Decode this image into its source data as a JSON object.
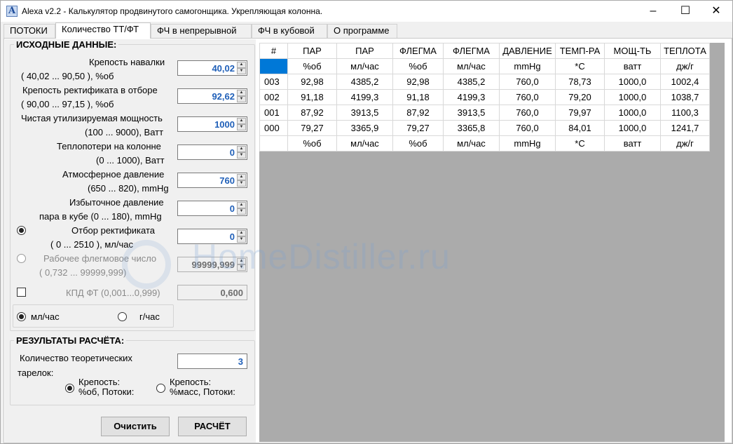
{
  "window": {
    "title": "Alexa  v2.2 - Калькулятор продвинутого самогонщика. Укрепляющая колонна.",
    "app_icon_letter": "A",
    "controls": {
      "minimize": "–",
      "maximize": "☐",
      "close": "✕"
    }
  },
  "tabs": [
    {
      "label": "ПОТОКИ",
      "active": false
    },
    {
      "label": "Количество ТТ/ФТ",
      "active": true
    },
    {
      "label": "ФЧ в непрерывной",
      "active": false
    },
    {
      "label": "ФЧ в кубовой",
      "active": false
    },
    {
      "label": "О программе",
      "active": false
    }
  ],
  "inputs": {
    "title": "ИСХОДНЫЕ ДАННЫЕ:",
    "fields": [
      {
        "label1": "Крепость навалки",
        "label2": "(       40,02     ...      90,50     ), %об",
        "value": "40,02"
      },
      {
        "label1": "Крепость ректификата в отборе",
        "label2": "(       90,00       ...      97,15 ), %об",
        "value": "92,62"
      },
      {
        "label1": "Чистая утилизируемая мощность",
        "label2": "(100 ... 9000), Ватт",
        "value": "1000"
      },
      {
        "label1": "Теплопотери на колонне",
        "label2": "(0 ... 1000), Ватт",
        "value": "0"
      },
      {
        "label1": "Атмосферное давление",
        "label2": "(650 ... 820), mmHg",
        "value": "760"
      },
      {
        "label1": "Избыточное давление",
        "label2": "пара в кубе (0 ... 180), mmHg",
        "value": "0"
      },
      {
        "label1": "Отбор ректификата",
        "label2": "(  0       ...       2510    ), мл/час",
        "value": "0"
      },
      {
        "label1": "Рабочее флегмовое число",
        "label2": "(       0,732      ... 99999,999)",
        "value": "99999,999"
      },
      {
        "label1": "КПД ФТ (0,001...0,999)",
        "value": "0,600"
      }
    ],
    "unit_options": {
      "ml": "мл/час",
      "g": "г/час"
    }
  },
  "results": {
    "title": "РЕЗУЛЬТАТЫ РАСЧЁТА:",
    "plates_label1": "Количество      теоретических",
    "plates_label2": "тарелок:",
    "plates_value": "3",
    "opt1_line1": "Крепость:",
    "opt1_line2": "%об, Потоки:",
    "opt2_line1": "Крепость:",
    "opt2_line2": "%масс, Потоки:"
  },
  "buttons": {
    "clear": "Очистить",
    "calc": "РАСЧЁТ"
  },
  "table": {
    "headers": [
      "#",
      "ПАР",
      "ПАР",
      "ФЛЕГМА",
      "ФЛЕГМА",
      "ДАВЛЕНИЕ",
      "ТЕМП-РА",
      "МОЩ-ТЬ",
      "ТЕПЛОТА"
    ],
    "units": [
      "",
      "%об",
      "мл/час",
      "%об",
      "мл/час",
      "mmHg",
      "*С",
      "ватт",
      "дж/г"
    ],
    "rows": [
      [
        "003",
        "92,98",
        "4385,2",
        "92,98",
        "4385,2",
        "760,0",
        "78,73",
        "1000,0",
        "1002,4"
      ],
      [
        "002",
        "91,18",
        "4199,3",
        "91,18",
        "4199,3",
        "760,0",
        "79,20",
        "1000,0",
        "1038,7"
      ],
      [
        "001",
        "87,92",
        "3913,5",
        "87,92",
        "3913,5",
        "760,0",
        "79,97",
        "1000,0",
        "1100,3"
      ],
      [
        "000",
        "79,27",
        "3365,9",
        "79,27",
        "3365,8",
        "760,0",
        "84,01",
        "1000,0",
        "1241,7"
      ]
    ],
    "units_bottom": [
      "",
      "%об",
      "мл/час",
      "%об",
      "мл/час",
      "mmHg",
      "*С",
      "ватт",
      "дж/г"
    ]
  },
  "watermark": "HomeDistiller.ru"
}
